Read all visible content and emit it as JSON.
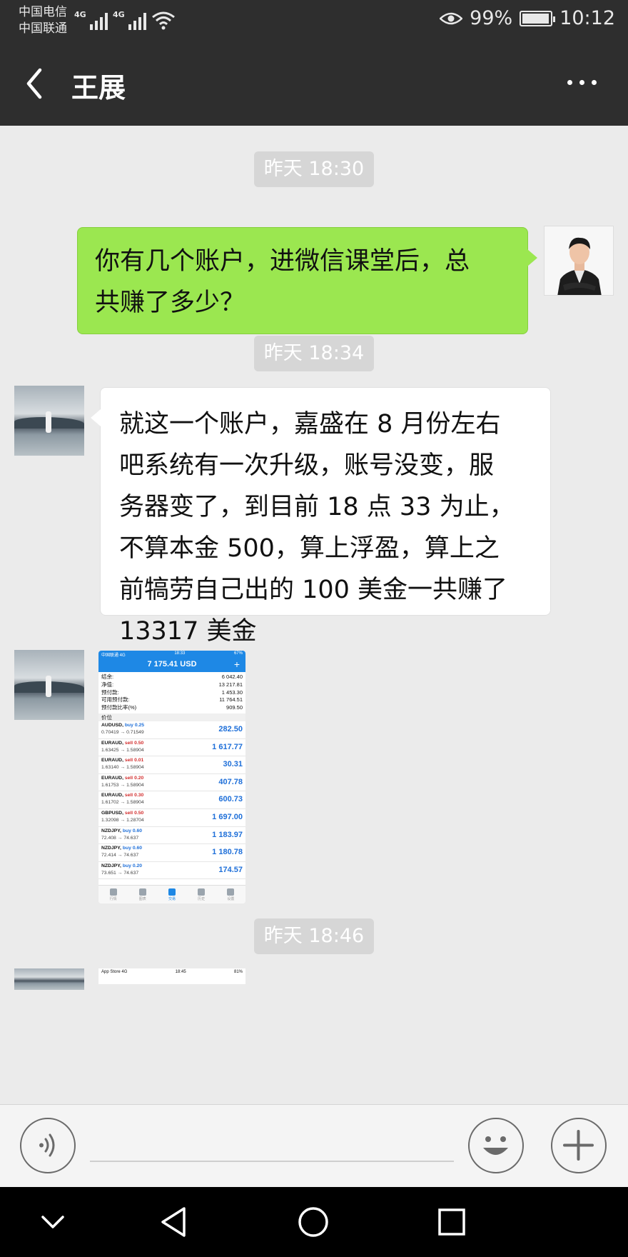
{
  "status_bar": {
    "carrier_1": "中国电信",
    "carrier_2": "中国联通",
    "network_1": "4G",
    "network_2": "4G",
    "battery": "99%",
    "time": "10:12"
  },
  "header": {
    "title": "王展",
    "back_icon": "chevron-left-icon",
    "more_icon": "more-dots-icon"
  },
  "messages": [
    {
      "type": "time",
      "text": "昨天 18:30"
    },
    {
      "type": "outgoing_text",
      "lines": [
        "你有几个账户，进微信课堂后，总",
        "共赚了多少？"
      ]
    },
    {
      "type": "time",
      "text": "昨天 18:34"
    },
    {
      "type": "incoming_text",
      "lines": [
        "就这一个账户，嘉盛在 8 月份左右",
        "吧系统有一次升级，账号没变，服",
        "务器变了，到目前 18 点 33 为止，",
        "不算本金 500，算上浮盈，算上之",
        "前犒劳自己出的 100 美金一共赚了",
        "13317 美金"
      ]
    },
    {
      "type": "incoming_image"
    },
    {
      "type": "time",
      "text": "昨天 18:46"
    },
    {
      "type": "incoming_image_partial"
    }
  ],
  "trade_screenshot": {
    "status_left": "中国联通 4G",
    "status_time": "18:33",
    "status_battery": "67%",
    "balance_title": "7 175.41 USD",
    "summary": [
      {
        "label": "结余:",
        "value": "6 042.40"
      },
      {
        "label": "净值:",
        "value": "13 217.81"
      },
      {
        "label": "预付款:",
        "value": "1 453.30"
      },
      {
        "label": "可用预付款:",
        "value": "11 764.51"
      },
      {
        "label": "预付款比率(%)",
        "value": "909.50"
      }
    ],
    "section_label": "价位",
    "positions": [
      {
        "symbol": "AUDUSD,",
        "side": "buy",
        "size": "0.25",
        "prices": "0.70419 → 0.71549",
        "profit": "282.50"
      },
      {
        "symbol": "EURAUD,",
        "side": "sell",
        "size": "0.50",
        "prices": "1.63425 → 1.58904",
        "profit": "1 617.77"
      },
      {
        "symbol": "EURAUD,",
        "side": "sell",
        "size": "0.01",
        "prices": "1.63140 → 1.58904",
        "profit": "30.31"
      },
      {
        "symbol": "EURAUD,",
        "side": "sell",
        "size": "0.20",
        "prices": "1.61753 → 1.58904",
        "profit": "407.78"
      },
      {
        "symbol": "EURAUD,",
        "side": "sell",
        "size": "0.30",
        "prices": "1.61702 → 1.58904",
        "profit": "600.73"
      },
      {
        "symbol": "GBPUSD,",
        "side": "sell",
        "size": "0.50",
        "prices": "1.32098 → 1.28704",
        "profit": "1 697.00"
      },
      {
        "symbol": "NZDJPY,",
        "side": "buy",
        "size": "0.60",
        "prices": "72.408 → 74.637",
        "profit": "1 183.97"
      },
      {
        "symbol": "NZDJPY,",
        "side": "buy",
        "size": "0.60",
        "prices": "72.414 → 74.637",
        "profit": "1 180.78"
      },
      {
        "symbol": "NZDJPY,",
        "side": "buy",
        "size": "0.20",
        "prices": "73.651 → 74.637",
        "profit": "174.57"
      }
    ],
    "tabs": [
      "行情",
      "图表",
      "交易",
      "历史",
      "设置"
    ]
  },
  "second_screenshot": {
    "status_left": "App Store",
    "status_network": "4G",
    "status_time": "18:45",
    "status_battery": "81%"
  },
  "input_bar": {
    "voice_icon": "voice-icon",
    "emoji_icon": "emoji-icon",
    "plus_icon": "plus-icon"
  },
  "system_nav": [
    "chevron-down-icon",
    "back-triangle-icon",
    "home-circle-icon",
    "recents-square-icon"
  ],
  "colors": {
    "header_bg": "#2e2e2e",
    "chat_bg": "#ebebeb",
    "outgoing_bubble": "#9be750",
    "incoming_bubble": "#ffffff",
    "trade_app_blue": "#1e88e5"
  }
}
